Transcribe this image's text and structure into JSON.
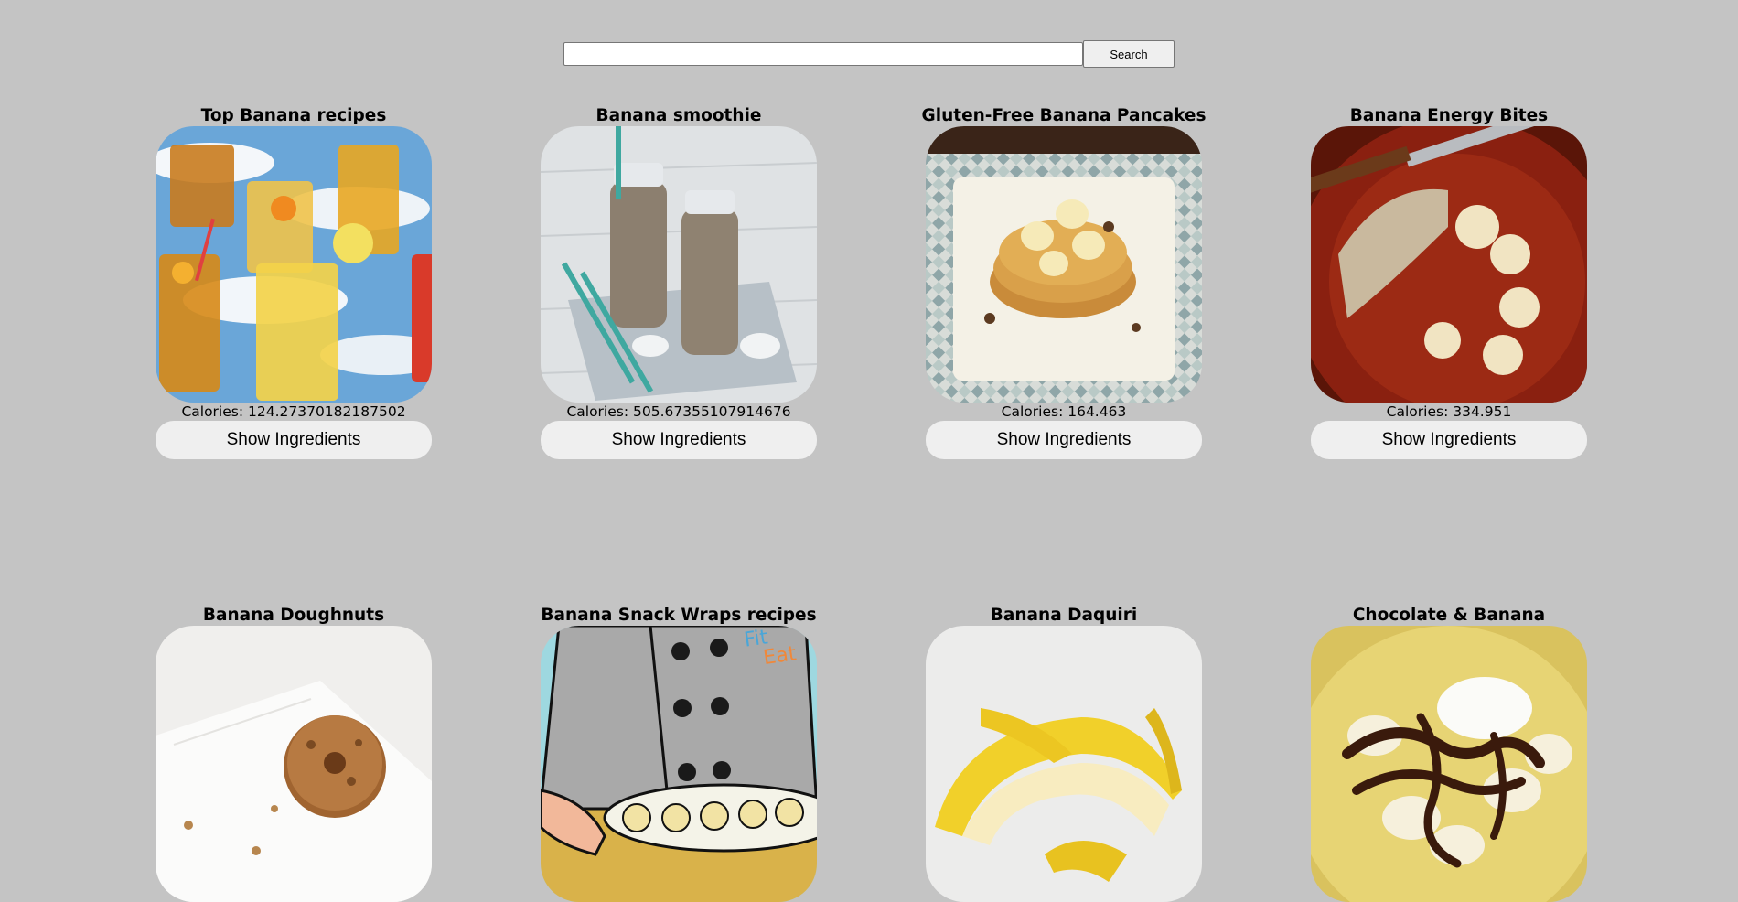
{
  "search": {
    "value": "",
    "placeholder": "",
    "button_label": "Search"
  },
  "recipes": [
    {
      "title": "Top Banana recipes",
      "calories": "Calories: 124.27370182187502",
      "button_label": "Show Ingredients",
      "image": "iced-drinks-photo"
    },
    {
      "title": "Banana smoothie",
      "calories": "Calories: 505.67355107914676",
      "button_label": "Show Ingredients",
      "image": "smoothie-bottles-photo"
    },
    {
      "title": "Gluten-Free Banana Pancakes",
      "calories": "Calories: 164.463",
      "button_label": "Show Ingredients",
      "image": "banana-pancakes-photo"
    },
    {
      "title": "Banana Energy Bites",
      "calories": "Calories: 334.951",
      "button_label": "Show Ingredients",
      "image": "energy-bites-photo"
    },
    {
      "title": "Banana Doughnuts",
      "image": "doughnut-photo"
    },
    {
      "title": "Banana Snack Wraps recipes",
      "image": "snack-wraps-illustration",
      "logo_text": [
        "Fit",
        "Eat"
      ]
    },
    {
      "title": "Banana Daquiri",
      "image": "peeled-banana-photo"
    },
    {
      "title": "Chocolate & Banana",
      "image": "chocolate-banana-photo"
    }
  ],
  "colors": {
    "background": "#c4c4c4",
    "button": "#efefef"
  }
}
